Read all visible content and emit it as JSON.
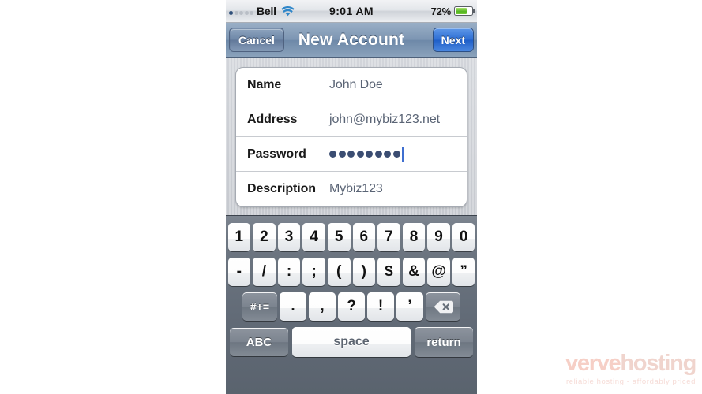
{
  "status_bar": {
    "carrier": "Bell",
    "signal_bars_filled": 1,
    "signal_bars_total": 5,
    "wifi_icon": "wifi-icon",
    "time": "9:01 AM",
    "battery_percent": "72%",
    "battery_level": 72,
    "battery_color": "#5cb82a"
  },
  "nav_bar": {
    "cancel_label": "Cancel",
    "title": "New Account",
    "next_label": "Next",
    "next_color": "#2f6fd4"
  },
  "form": {
    "fields": [
      {
        "label": "Name",
        "value": "John Doe",
        "type": "text"
      },
      {
        "label": "Address",
        "value": "john@mybiz123.net",
        "type": "email"
      },
      {
        "label": "Password",
        "value": "••••••••",
        "type": "password",
        "dots": 8,
        "focused": true
      },
      {
        "label": "Description",
        "value": "Mybiz123",
        "type": "text"
      }
    ]
  },
  "keyboard": {
    "row1": [
      "1",
      "2",
      "3",
      "4",
      "5",
      "6",
      "7",
      "8",
      "9",
      "0"
    ],
    "row2": [
      "-",
      "/",
      ":",
      ";",
      "(",
      ")",
      "$",
      "&",
      "@",
      "”"
    ],
    "row3": [
      ".",
      ",",
      "?",
      "!",
      "’"
    ],
    "shift_label": "#+=",
    "delete_icon": "backspace-icon",
    "abc_label": "ABC",
    "space_label": "space",
    "return_label": "return"
  },
  "watermark": {
    "brand_first": "verve",
    "brand_second": "hosting",
    "tagline": "reliable hosting - affordably priced"
  }
}
